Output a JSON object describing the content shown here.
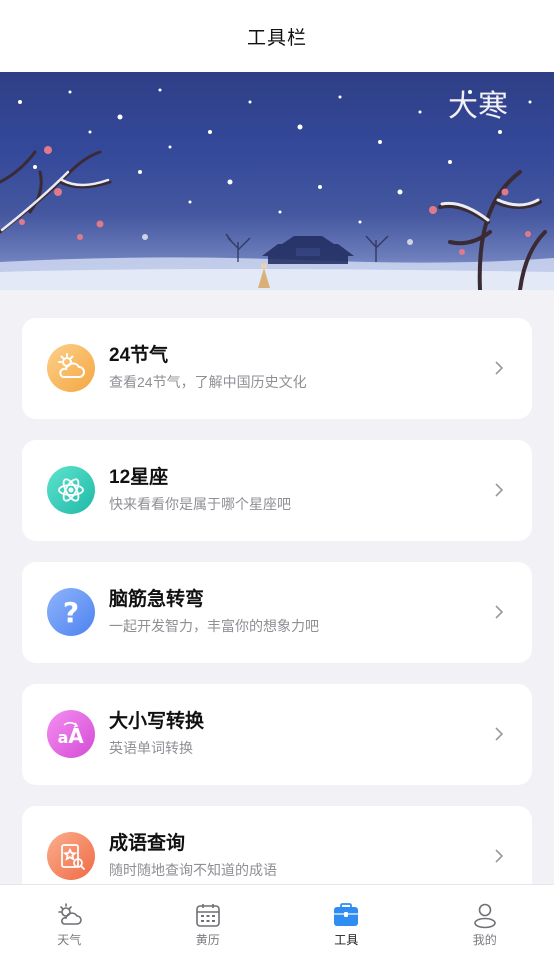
{
  "header": {
    "title": "工具栏"
  },
  "banner": {
    "text": "大寒"
  },
  "tools": [
    {
      "title": "24节气",
      "subtitle": "查看24节气，了解中国历史文化",
      "icon": "weather-cloud-icon",
      "color": "#f6b251"
    },
    {
      "title": "12星座",
      "subtitle": "快来看看你是属于哪个星座吧",
      "icon": "atom-icon",
      "color": "#2ec7b3"
    },
    {
      "title": "脑筋急转弯",
      "subtitle": "一起开发智力，丰富你的想象力吧",
      "icon": "question-icon",
      "color": "#5b8ff5"
    },
    {
      "title": "大小写转换",
      "subtitle": "英语单词转换",
      "icon": "case-convert-icon",
      "color": "#e25ad9"
    },
    {
      "title": "成语查询",
      "subtitle": "随时随地查询不知道的成语",
      "icon": "idiom-search-icon",
      "color": "#f3784f"
    }
  ],
  "tabs": [
    {
      "label": "天气",
      "icon": "weather-icon",
      "active": false
    },
    {
      "label": "黄历",
      "icon": "calendar-icon",
      "active": false
    },
    {
      "label": "工具",
      "icon": "toolbox-icon",
      "active": true
    },
    {
      "label": "我的",
      "icon": "user-icon",
      "active": false
    }
  ],
  "colors": {
    "accent": "#2f8cf2",
    "background": "#f2f1f6"
  }
}
